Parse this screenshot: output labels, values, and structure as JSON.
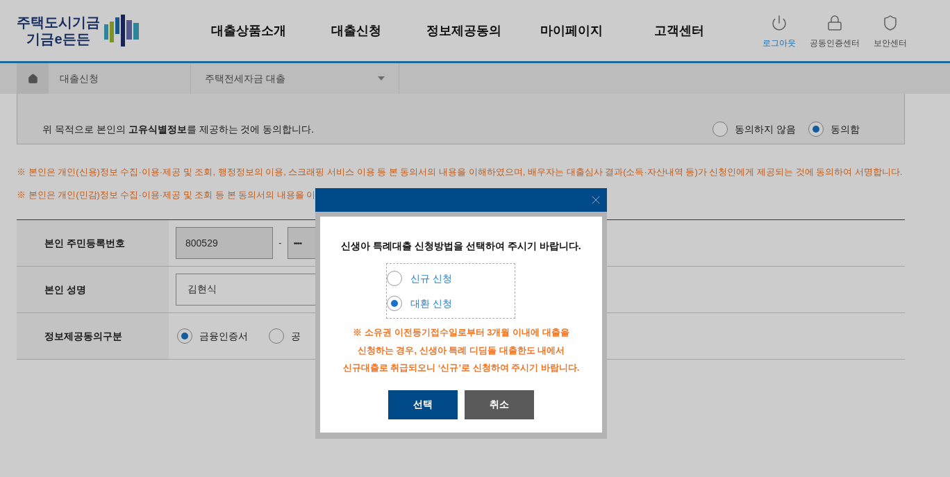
{
  "header": {
    "logo": {
      "line1": "주택도시기금",
      "line2": "기금e든든"
    },
    "nav": [
      "대출상품소개",
      "대출신청",
      "정보제공동의",
      "마이페이지",
      "고객센터"
    ],
    "utilities": [
      {
        "label": "로그아웃",
        "kind": "power",
        "highlighted": true
      },
      {
        "label": "공동인증센터",
        "kind": "lock",
        "highlighted": false
      },
      {
        "label": "보안센터",
        "kind": "shield",
        "highlighted": false
      }
    ]
  },
  "breadcrumb": {
    "items": [
      "대출신청",
      "주택전세자금 대출"
    ]
  },
  "consent": {
    "text": "위 목적으로 본인의 **고유식별정보**를 제공하는 것에 동의합니다.",
    "options": [
      {
        "label": "동의하지 않음",
        "selected": false
      },
      {
        "label": "동의함",
        "selected": true
      }
    ]
  },
  "notes": [
    "※ 본인은 개인(신용)정보 수집·이용·제공 및 조회, 행정정보의 이용, 스크래핑 서비스 이용 등 본 동의서의 내용을 이해하였으며, 배우자는 대출심사 결과(소득·자산내역 등)가 신청인에게 제공되는 것에 동의하여 서명합니다.",
    "※ 본인은 개인(민감)정보 수집·이용·제공 및 조회 등 본 동의서의 내용을 이"
  ],
  "form": {
    "rows": [
      {
        "kind": "rrn",
        "label": "본인 주민등록번호",
        "value": "800529",
        "separator": "-",
        "masked": "••••"
      },
      {
        "kind": "text",
        "label": "본인 성명",
        "value": "김현식"
      },
      {
        "kind": "radio",
        "label": "정보제공동의구분",
        "options": [
          {
            "label": "금융인증서",
            "selected": true
          },
          {
            "label": "공",
            "selected": false
          }
        ]
      }
    ]
  },
  "dialog": {
    "message": "신생아 특례대출 신청방법을 선택하여 주시기 바랍니다.",
    "options": [
      {
        "label": "신규 신청",
        "selected": false
      },
      {
        "label": "대환 신청",
        "selected": true
      }
    ],
    "notice": [
      "※ 소유권 이전등기접수일로부터 3개월 이내에 대출을",
      "신청하는 경우, 신생아 특례 디딤돌 대출한도 내에서",
      "신규대출로 취급되오니 ‘신규’로 신청하여 주시기 바랍니다."
    ],
    "buttons": [
      {
        "label": "선택",
        "kind": "primary"
      },
      {
        "label": "취소",
        "kind": "secondary"
      }
    ]
  }
}
